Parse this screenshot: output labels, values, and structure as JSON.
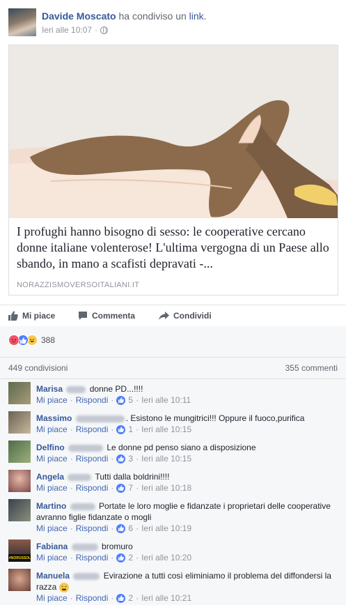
{
  "post": {
    "author": "Davide Moscato",
    "action": "ha condiviso un",
    "action_link": "link.",
    "time": "Ieri alle 10:07",
    "dot": "·"
  },
  "link_card": {
    "title": "I profughi hanno bisogno di sesso: le cooperative cercano donne italiane volenterose! L'ultima vergogna di un Paese allo sbando, in mano a scafisti depravati -...",
    "domain": "NORAZZISMOVERSOITALIANI.IT"
  },
  "actions": {
    "like": "Mi piace",
    "comment": "Commenta",
    "share": "Condividi"
  },
  "reactions": {
    "icons": [
      "angry-icon",
      "like-icon",
      "haha-icon"
    ],
    "count": "388"
  },
  "counts": {
    "shares": "449 condivisioni",
    "comments": "355 commenti"
  },
  "comment_actions": {
    "like": "Mi piace",
    "reply": "Rispondi",
    "sep": "·"
  },
  "comments": [
    {
      "name": "Marisa",
      "text": "donne PD...!!!!",
      "likes": "5",
      "time": "Ieri alle 10:11"
    },
    {
      "name": "Massimo",
      "text": ". Esistono le mungitrici!!! Oppure il fuoco,purifica",
      "likes": "1",
      "time": "Ieri alle 10:15"
    },
    {
      "name": "Delfino",
      "text": "Le donne pd penso siano a disposizione",
      "likes": "3",
      "time": "Ieri alle 10:15"
    },
    {
      "name": "Angela",
      "text": "Tutti dalla boldrini!!!!",
      "likes": "7",
      "time": "Ieri alle 10:18"
    },
    {
      "name": "Martino",
      "text": "Portate le loro moglie e fidanzate i proprietari delle cooperative avranno figlie fidanzate o mogli",
      "likes": "6",
      "time": "Ieri alle 10:19"
    },
    {
      "name": "Fabiana",
      "text": "bromuro",
      "likes": "2",
      "time": "Ieri alle 10:20",
      "avatar_text": "#NORUSSOL"
    },
    {
      "name": "Manuela",
      "text": "Evirazione a tutti così eliminiamo il problema del diffondersi la razza",
      "likes": "2",
      "time": "Ieri alle 10:21"
    }
  ],
  "colors": {
    "link_blue": "#365899",
    "action_blue": "#4267b2",
    "meta_gray": "#90949c",
    "ufi_bg": "#f6f7f9"
  }
}
